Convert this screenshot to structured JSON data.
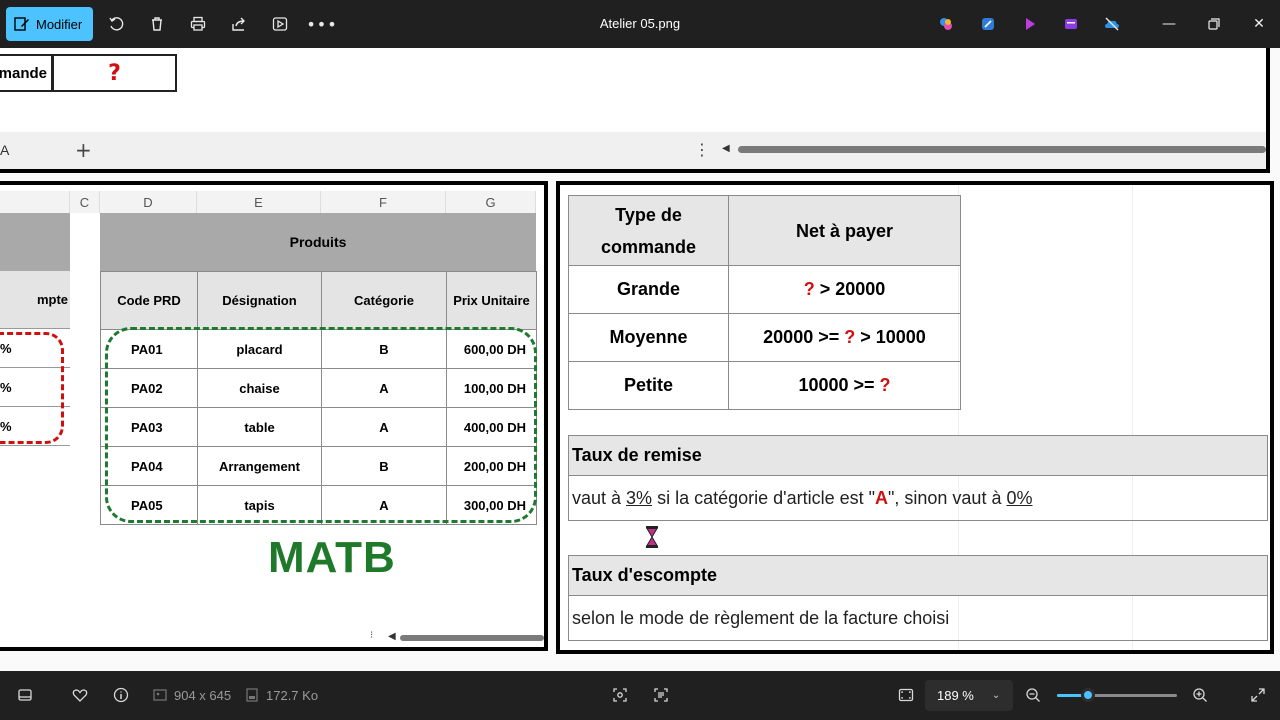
{
  "toolbar": {
    "modify_label": "Modifier",
    "file_title": "Atelier 05.png"
  },
  "top_fragment": {
    "cell_label": "mande",
    "cell_value": "?",
    "sheet_tab": "A",
    "add_sheet": "+",
    "sheet_menu": "⋮"
  },
  "products": {
    "columns": [
      "C",
      "D",
      "E",
      "F",
      "G"
    ],
    "title": "Produits",
    "left_header": "mpte",
    "left_values": [
      "%",
      "%",
      "%"
    ],
    "headers": [
      "Code PRD",
      "Désignation",
      "Catégorie",
      "Prix Unitaire"
    ],
    "rows": [
      {
        "code": "PA01",
        "designation": "placard",
        "categorie": "B",
        "prix": "600,00 DH"
      },
      {
        "code": "PA02",
        "designation": "chaise",
        "categorie": "A",
        "prix": "100,00 DH"
      },
      {
        "code": "PA03",
        "designation": "table",
        "categorie": "A",
        "prix": "400,00 DH"
      },
      {
        "code": "PA04",
        "designation": "Arrangement",
        "categorie": "B",
        "prix": "200,00 DH"
      },
      {
        "code": "PA05",
        "designation": "tapis",
        "categorie": "A",
        "prix": "300,00 DH"
      }
    ],
    "watermark": "MATB"
  },
  "order_types": {
    "header_type_line1": "Type de",
    "header_type_line2": "commande",
    "header_net": "Net à payer",
    "rows": [
      {
        "type": "Grande",
        "pre": "",
        "q": "?",
        "post": " >  20000"
      },
      {
        "type": "Moyenne",
        "pre": "20000  >= ",
        "q": "?",
        "post": " > 10000"
      },
      {
        "type": "Petite",
        "pre": "10000  >= ",
        "q": "?",
        "post": ""
      }
    ]
  },
  "remise": {
    "title": "Taux de remise",
    "t1": "vaut à ",
    "p1": "3%",
    "t2": " si la catégorie d'article est \"",
    "cat": "A",
    "t3": "\", sinon vaut à ",
    "p2": "0%"
  },
  "escompte": {
    "title": "Taux d'escompte",
    "body": "selon le mode de règlement de la facture choisi"
  },
  "status": {
    "dimensions": "904 x 645",
    "file_size": "172.7 Ko",
    "zoom": "189 %",
    "zoom_fraction": 0.26
  },
  "colors": {
    "accent": "#4cc2ff",
    "question_red": "#d01010",
    "matb_green": "#1e7a2a"
  }
}
